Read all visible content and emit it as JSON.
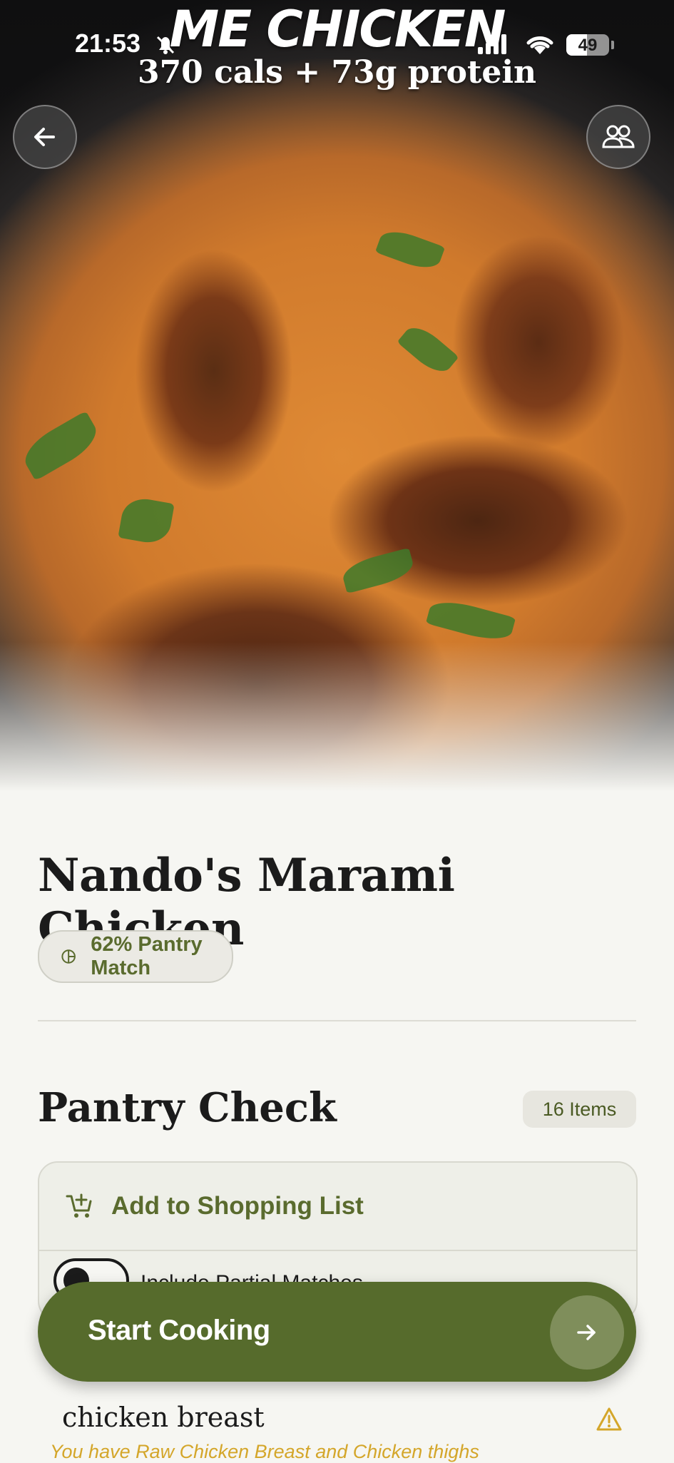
{
  "status_bar": {
    "time": "21:53",
    "battery": "49",
    "battery_level": 0.49
  },
  "hero": {
    "overlay_title": "ME CHICKEN",
    "overlay_subtitle": "370 cals + 73g protein"
  },
  "icons": {
    "back": "arrow-left-icon",
    "people": "people-icon",
    "pantry": "pie-chart-icon",
    "cart": "cart-plus-icon",
    "arrow": "arrow-right-icon",
    "warning": "warning-icon"
  },
  "recipe": {
    "title": "Nando's Marami Chicken",
    "pantry_match": "62% Pantry Match"
  },
  "pantry_check": {
    "title": "Pantry Check",
    "items_count": "16 Items",
    "add_to_list": "Add to Shopping List",
    "include_partial": "Include Partial Matches",
    "include_partial_on": false
  },
  "actions": {
    "start_cooking": "Start Cooking"
  },
  "ingredients": [
    {
      "name": "chicken breast",
      "note": "You have Raw Chicken Breast and Chicken thighs"
    }
  ],
  "colors": {
    "accent": "#566b2c",
    "accent_text": "#5a6b2e",
    "warning": "#d4a62a",
    "background": "#f6f6f2"
  }
}
